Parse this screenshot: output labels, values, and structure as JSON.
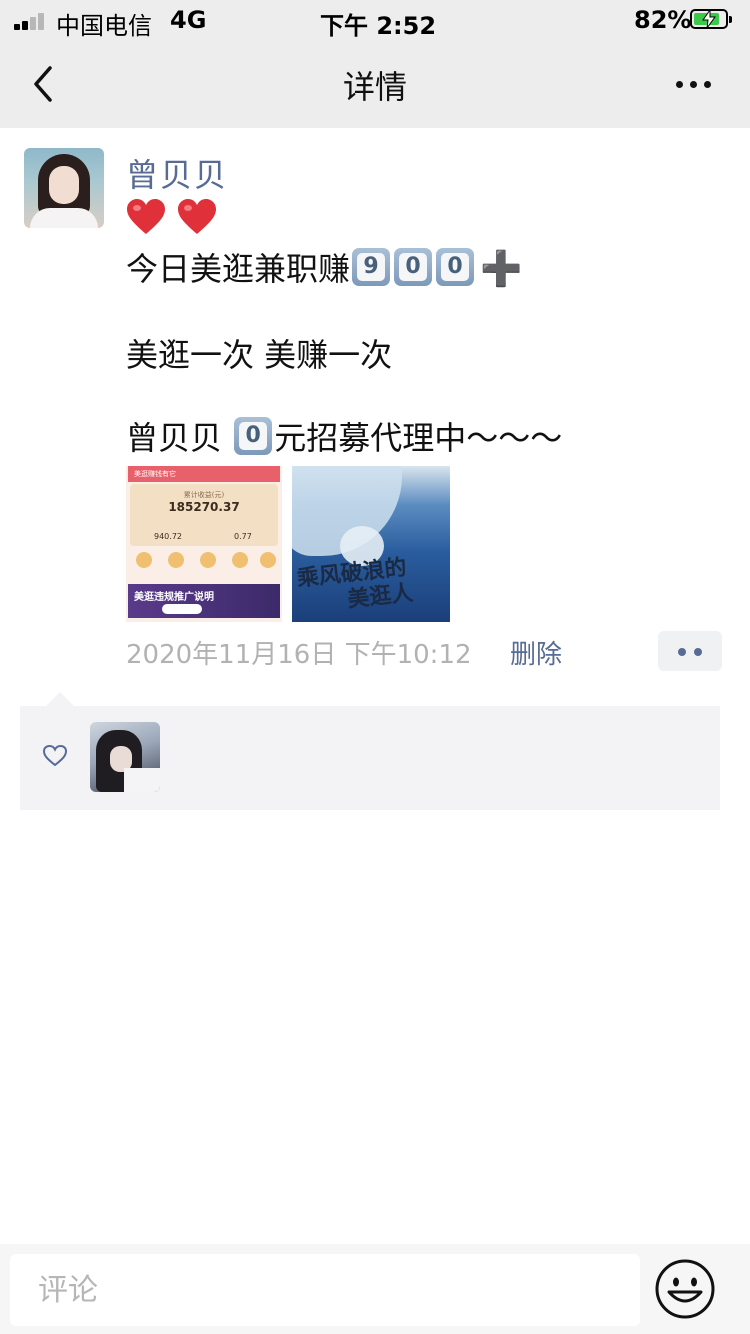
{
  "status_bar": {
    "carrier": "中国电信",
    "network": "4G",
    "time": "下午 2:52",
    "battery_percent": "82%",
    "battery_level": 0.82,
    "signal_bars": 2
  },
  "nav": {
    "title": "详情",
    "back_icon": "chevron-left-icon",
    "more_icon": "more-dots-icon"
  },
  "post": {
    "author": "曾贝贝",
    "line1": "今日美逛兼职赚",
    "line1_keycaps": [
      "9",
      "0",
      "0"
    ],
    "line1_suffix": "➕",
    "line2": "美逛一次 美赚一次",
    "line3_prefix": "曾贝贝 ",
    "line3_keycap": "0",
    "line3_suffix": "元招募代理中～～～",
    "images": {
      "first": {
        "header": "美逛赚钱有它",
        "label": "累计收益(元)",
        "value": "185270.37",
        "stat1": "940.72",
        "stat2": "0.77",
        "banner": "美逛违规推广说明"
      },
      "second": {
        "title_line1": "乘风破浪的",
        "title_line2": "美逛人"
      }
    },
    "time": "2020年11月16日 下午10:12",
    "delete_label": "删除"
  },
  "likes": {
    "icon": "heart-outline-icon",
    "count": 1
  },
  "comment_bar": {
    "placeholder": "评论",
    "emoji_icon": "smiley-icon"
  },
  "colors": {
    "link_blue": "#576b95",
    "nav_bg": "#ededed",
    "meta_gray": "#b2b2b2",
    "panel_bg": "#f3f3f5"
  }
}
